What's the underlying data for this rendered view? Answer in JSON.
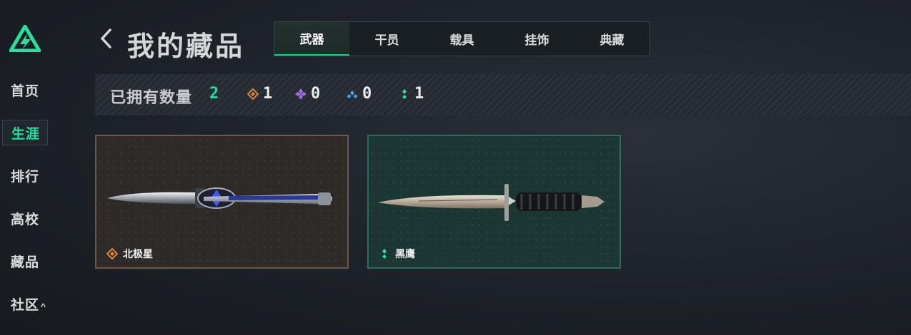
{
  "sidebar": {
    "items": [
      {
        "label": "首页"
      },
      {
        "label": "生涯"
      },
      {
        "label": "排行"
      },
      {
        "label": "高校"
      },
      {
        "label": "藏品"
      },
      {
        "label": "社区",
        "caret": "^"
      }
    ]
  },
  "header": {
    "title": "我的藏品"
  },
  "tabs": [
    {
      "label": "武器"
    },
    {
      "label": "干员"
    },
    {
      "label": "载具"
    },
    {
      "label": "挂饰"
    },
    {
      "label": "典藏"
    }
  ],
  "stats": {
    "owned_label": "已拥有数量",
    "total": "2",
    "rarities": [
      {
        "icon": "orange-diamond-icon",
        "color": "#e0843f",
        "count": "1"
      },
      {
        "icon": "purple-diamond-icon",
        "color": "#9b6ce0",
        "count": "0"
      },
      {
        "icon": "blue-diamond-icon",
        "color": "#4aa0e8",
        "count": "0"
      },
      {
        "icon": "green-dots-icon",
        "color": "#27e0a0",
        "count": "1"
      }
    ]
  },
  "cards": [
    {
      "name": "北极星",
      "rarity_icon": "orange-diamond-icon",
      "rarity_color": "#e0843f"
    },
    {
      "name": "黑鹰",
      "rarity_icon": "green-dots-icon",
      "rarity_color": "#27e0a0"
    }
  ],
  "colors": {
    "accent": "#27e0a0"
  }
}
